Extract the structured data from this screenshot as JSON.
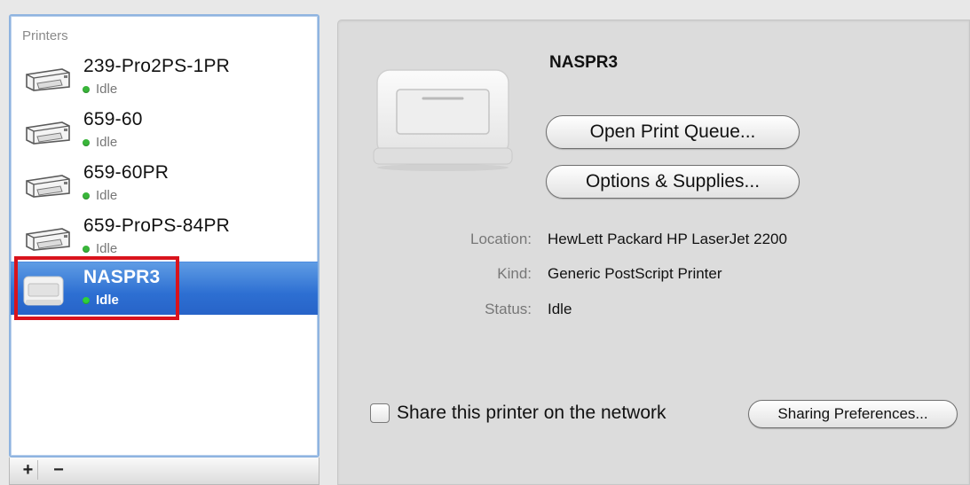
{
  "sidebar": {
    "header": "Printers",
    "printers": [
      {
        "name": "239-Pro2PS-1PR",
        "status": "Idle"
      },
      {
        "name": "659-60",
        "status": "Idle"
      },
      {
        "name": "659-60PR",
        "status": "Idle"
      },
      {
        "name": "659-ProPS-84PR",
        "status": "Idle"
      },
      {
        "name": "NASPR3",
        "status": "Idle"
      }
    ],
    "selected": "NASPR3",
    "add_label": "+",
    "remove_label": "−"
  },
  "detail": {
    "printer_name": "NASPR3",
    "open_queue_label": "Open Print Queue...",
    "options_label": "Options & Supplies...",
    "location_label": "Location:",
    "location_value": "HewLett Packard HP LaserJet 2200",
    "kind_label": "Kind:",
    "kind_value": "Generic PostScript Printer",
    "status_label": "Status:",
    "status_value": "Idle",
    "share_label": "Share this printer on the network",
    "share_checked": false,
    "sharing_prefs_label": "Sharing Preferences..."
  },
  "colors": {
    "selection": "#2d6fd2",
    "status_dot": "#39b53a",
    "highlight_box": "#d9131c"
  }
}
